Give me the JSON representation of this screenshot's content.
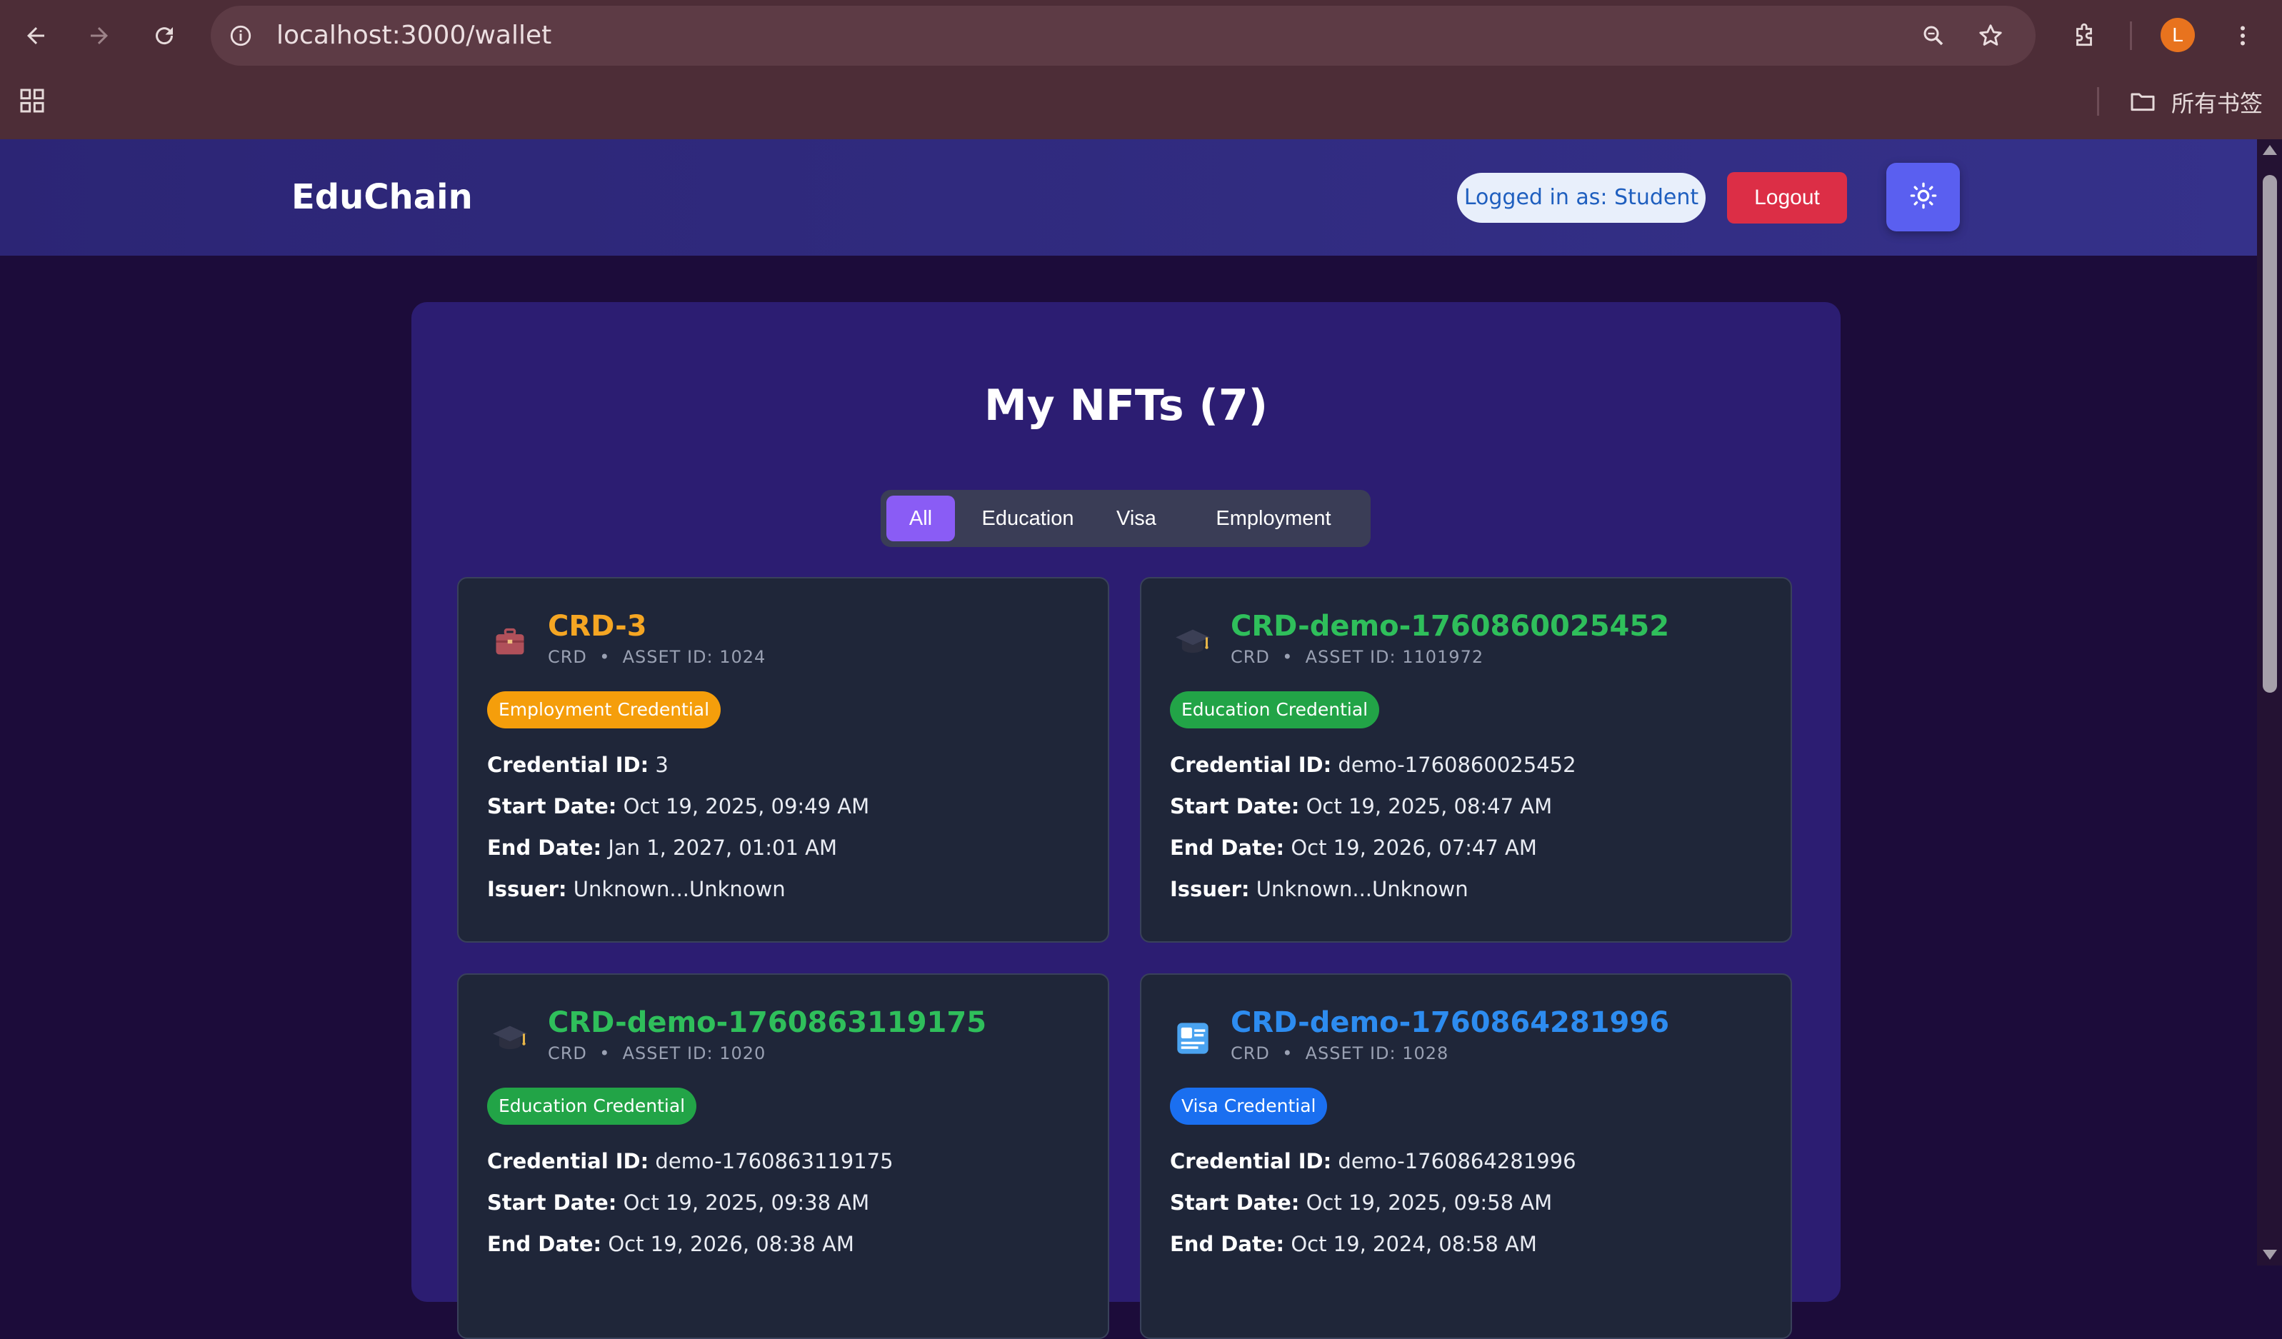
{
  "browser": {
    "url": "localhost:3000/wallet",
    "profile_initial": "L",
    "bookmarks_label": "所有书签",
    "icons": [
      "back-arrow-icon",
      "forward-arrow-icon",
      "reload-icon",
      "site-info-icon",
      "zoom-icon",
      "star-icon",
      "extensions-icon",
      "menu-icon",
      "apps-icon",
      "folder-icon"
    ]
  },
  "header": {
    "brand": "EduChain",
    "login_status": "Logged in as: Student",
    "logout_label": "Logout",
    "theme_icon": "sun-icon"
  },
  "wallet": {
    "title": "My NFTs (7)",
    "filters": [
      "All",
      "Education",
      "Visa",
      "Employment"
    ],
    "active_filter": "All",
    "cards": [
      {
        "icon": "briefcase-icon",
        "title": "CRD-3",
        "title_color": "#f5a623",
        "unit": "CRD",
        "sep": "•",
        "asset": "ASSET ID: 1024",
        "badge": "Employment Credential",
        "badge_color": "#f59e0b",
        "credential_id_label": "Credential ID:",
        "credential_id": "3",
        "start_label": "Start Date:",
        "start": "Oct 19, 2025, 09:49 AM",
        "end_label": "End Date:",
        "end": "Jan 1, 2027, 01:01 AM",
        "issuer_label": "Issuer:",
        "issuer": "Unknown...Unknown"
      },
      {
        "icon": "graduation-cap-icon",
        "title": "CRD-demo-1760860025452",
        "title_color": "#2fbf5b",
        "unit": "CRD",
        "sep": "•",
        "asset": "ASSET ID: 1101972",
        "badge": "Education Credential",
        "badge_color": "#22a447",
        "credential_id_label": "Credential ID:",
        "credential_id": "demo-1760860025452",
        "start_label": "Start Date:",
        "start": "Oct 19, 2025, 08:47 AM",
        "end_label": "End Date:",
        "end": "Oct 19, 2026, 07:47 AM",
        "issuer_label": "Issuer:",
        "issuer": "Unknown...Unknown"
      },
      {
        "icon": "graduation-cap-icon",
        "title": "CRD-demo-1760863119175",
        "title_color": "#2fbf5b",
        "unit": "CRD",
        "sep": "•",
        "asset": "ASSET ID: 1020",
        "badge": "Education Credential",
        "badge_color": "#22a447",
        "credential_id_label": "Credential ID:",
        "credential_id": "demo-1760863119175",
        "start_label": "Start Date:",
        "start": "Oct 19, 2025, 09:38 AM",
        "end_label": "End Date:",
        "end": "Oct 19, 2026, 08:38 AM"
      },
      {
        "icon": "passport-icon",
        "title": "CRD-demo-1760864281996",
        "title_color": "#2d8cf0",
        "unit": "CRD",
        "sep": "•",
        "asset": "ASSET ID: 1028",
        "badge": "Visa Credential",
        "badge_color": "#1a6ff0",
        "credential_id_label": "Credential ID:",
        "credential_id": "demo-1760864281996",
        "start_label": "Start Date:",
        "start": "Oct 19, 2025, 09:58 AM",
        "end_label": "End Date:",
        "end": "Oct 19, 2024, 08:58 AM"
      }
    ]
  }
}
